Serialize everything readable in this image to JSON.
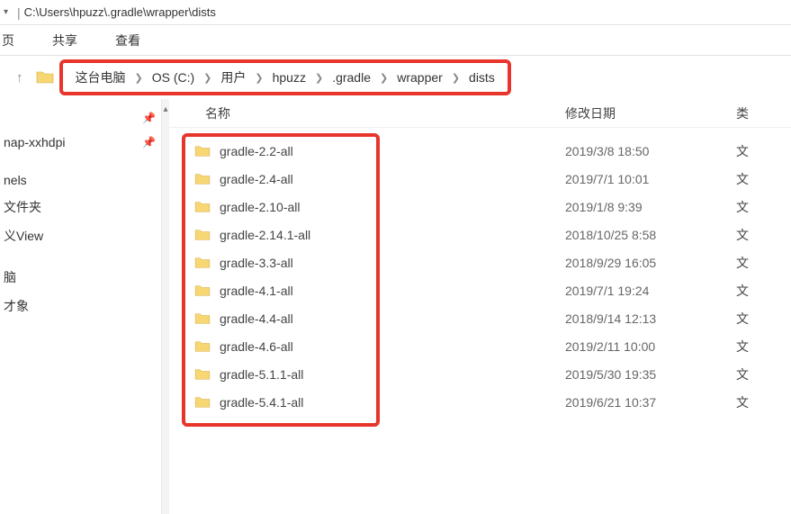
{
  "title_path": "C:\\Users\\hpuzz\\.gradle\\wrapper\\dists",
  "menu": {
    "items": [
      "页",
      "共享",
      "查看"
    ]
  },
  "breadcrumb": {
    "segments": [
      "这台电脑",
      "OS (C:)",
      "用户",
      "hpuzz",
      ".gradle",
      "wrapper",
      "dists"
    ]
  },
  "sidebar": {
    "items": [
      {
        "label": "",
        "pinned": true
      },
      {
        "label": "nap-xxhdpi",
        "pinned": true
      },
      {
        "label": "nels",
        "spaced": true
      },
      {
        "label": "文件夹"
      },
      {
        "label": "义View"
      },
      {
        "label": "脑",
        "spaced": true
      },
      {
        "label": "才象"
      }
    ]
  },
  "columns": {
    "name": "名称",
    "date": "修改日期",
    "type": "类"
  },
  "files": [
    {
      "name": "gradle-2.2-all",
      "date": "2019/3/8 18:50",
      "type": "文"
    },
    {
      "name": "gradle-2.4-all",
      "date": "2019/7/1 10:01",
      "type": "文"
    },
    {
      "name": "gradle-2.10-all",
      "date": "2019/1/8 9:39",
      "type": "文"
    },
    {
      "name": "gradle-2.14.1-all",
      "date": "2018/10/25 8:58",
      "type": "文"
    },
    {
      "name": "gradle-3.3-all",
      "date": "2018/9/29 16:05",
      "type": "文"
    },
    {
      "name": "gradle-4.1-all",
      "date": "2019/7/1 19:24",
      "type": "文"
    },
    {
      "name": "gradle-4.4-all",
      "date": "2018/9/14 12:13",
      "type": "文"
    },
    {
      "name": "gradle-4.6-all",
      "date": "2019/2/11 10:00",
      "type": "文"
    },
    {
      "name": "gradle-5.1.1-all",
      "date": "2019/5/30 19:35",
      "type": "文"
    },
    {
      "name": "gradle-5.4.1-all",
      "date": "2019/6/21 10:37",
      "type": "文"
    }
  ]
}
